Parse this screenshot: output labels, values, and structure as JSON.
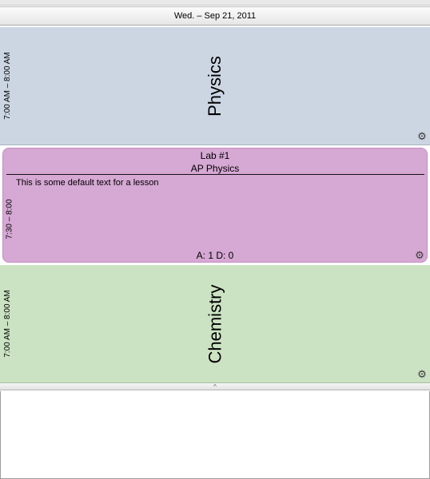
{
  "header": {
    "date": "Wed. – Sep 21, 2011"
  },
  "blocks": [
    {
      "subject": "Physics",
      "time": "7:00 AM – 8:00 AM",
      "color": "#ccd6e3",
      "settings_icon": "gear-icon"
    },
    {
      "subject": "Chemistry",
      "time": "7:00 AM – 8:00 AM",
      "color": "#cce3c3",
      "settings_icon": "gear-icon"
    }
  ],
  "lesson": {
    "title": "Lab #1",
    "course": "AP Physics",
    "text": "This is some default text for a lesson",
    "time": "7:30 – 8:00",
    "stats": "A: 1 D: 0",
    "color": "#d6a8d4",
    "settings_icon": "gear-icon"
  },
  "splitter": {
    "icon": "chevron-up-icon"
  }
}
